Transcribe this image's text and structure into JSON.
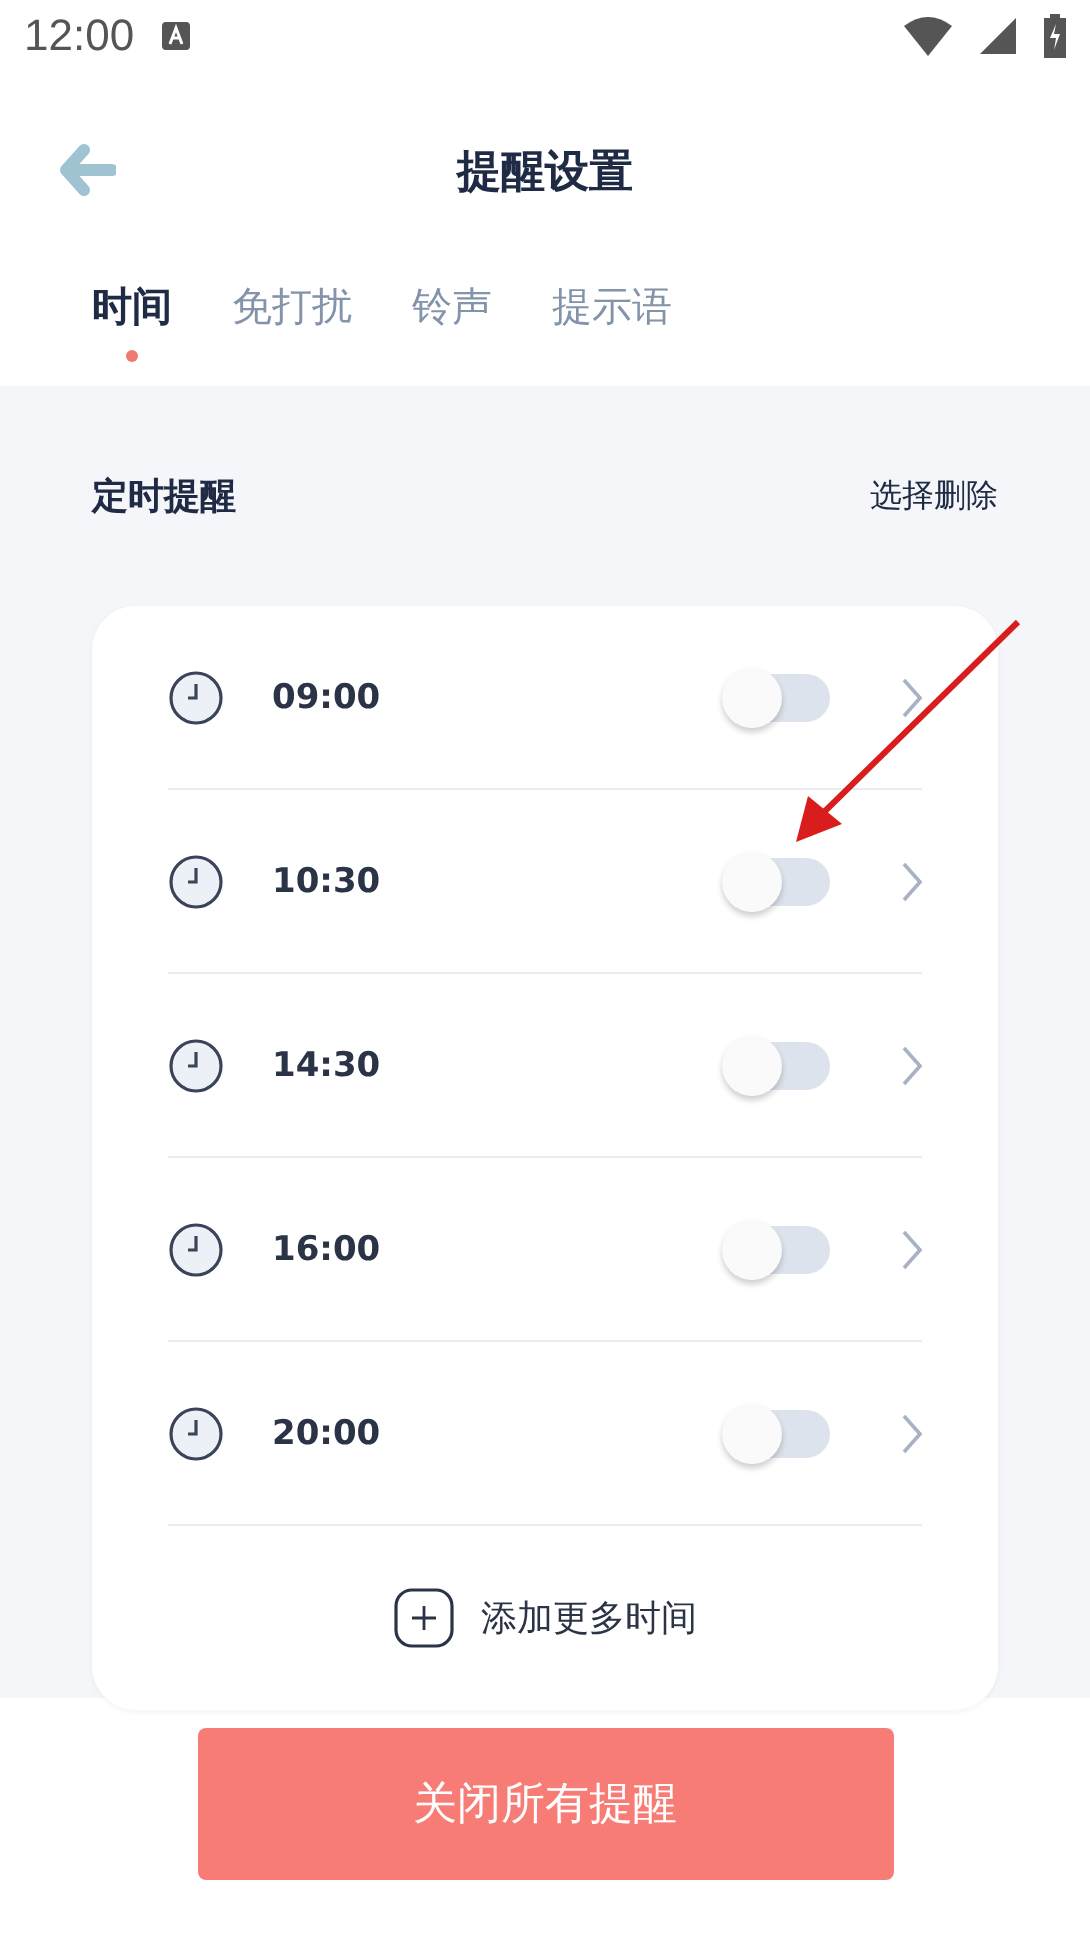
{
  "status_bar": {
    "time": "12:00"
  },
  "header": {
    "title": "提醒设置"
  },
  "tabs": [
    {
      "label": "时间",
      "selected": true
    },
    {
      "label": "免打扰",
      "selected": false
    },
    {
      "label": "铃声",
      "selected": false
    },
    {
      "label": "提示语",
      "selected": false
    }
  ],
  "section": {
    "title": "定时提醒",
    "action": "选择删除"
  },
  "reminders": [
    {
      "time": "09:00",
      "on": false
    },
    {
      "time": "10:30",
      "on": false
    },
    {
      "time": "14:30",
      "on": false
    },
    {
      "time": "16:00",
      "on": false
    },
    {
      "time": "20:00",
      "on": false
    }
  ],
  "add_button": "添加更多时间",
  "close_all_button": "关闭所有提醒"
}
